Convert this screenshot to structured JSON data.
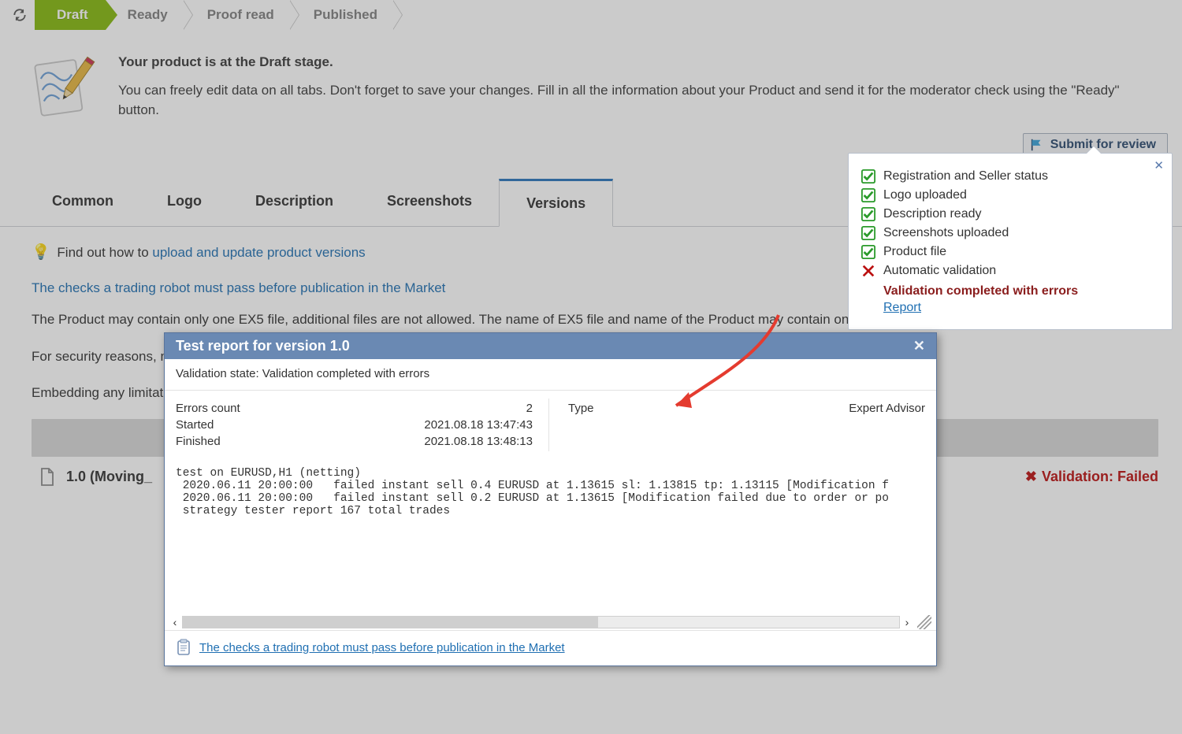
{
  "stages": {
    "s0": "Draft",
    "s1": "Ready",
    "s2": "Proof read",
    "s3": "Published"
  },
  "info": {
    "head": "Your product is at the Draft stage.",
    "body": "You can freely edit data on all tabs. Don't forget to save your changes. Fill in all the information about your Product and send it for the moderator check using the \"Ready\" button."
  },
  "submit_label": "Submit for review",
  "tabs": {
    "t0": "Common",
    "t1": "Logo",
    "t2": "Description",
    "t3": "Screenshots",
    "t4": "Versions"
  },
  "hint_prefix": "Find out how to ",
  "hint_link": "upload and update product versions",
  "checks_link": "The checks a trading robot must pass before publication in the Market",
  "para1": "The Product may contain only one EX5 file, additional files are not allowed. The name of EX5 file and name of the Product may contain only Latin characters. T",
  "para2": "For security reasons, must create the necessary file and mind that all products are check",
  "para3": "Embedding any limitations will be considered as unfr",
  "version_row": {
    "label": "1.0 (Moving_",
    "status": "Validation: Failed"
  },
  "checklist": {
    "c0": "Registration and Seller status",
    "c1": "Logo uploaded",
    "c2": "Description ready",
    "c3": "Screenshots uploaded",
    "c4": "Product file",
    "c5": "Automatic validation",
    "err": "Validation completed with errors",
    "report": "Report"
  },
  "modal": {
    "title": "Test report for version 1.0",
    "state_label": "Validation state: ",
    "state_value": "Validation completed with errors",
    "errors_l": "Errors count",
    "errors_v": "2",
    "started_l": "Started",
    "started_v": "2021.08.18 13:47:43",
    "finished_l": "Finished",
    "finished_v": "2021.08.18 13:48:13",
    "type_l": "Type",
    "type_v": "Expert Advisor",
    "log": "test on EURUSD,H1 (netting)\n 2020.06.11 20:00:00   failed instant sell 0.4 EURUSD at 1.13615 sl: 1.13815 tp: 1.13115 [Modification f\n 2020.06.11 20:00:00   failed instant sell 0.2 EURUSD at 1.13615 [Modification failed due to order or po\n strategy tester report 167 total trades",
    "footer_link": "The checks a trading robot must pass before publication in the Market"
  }
}
